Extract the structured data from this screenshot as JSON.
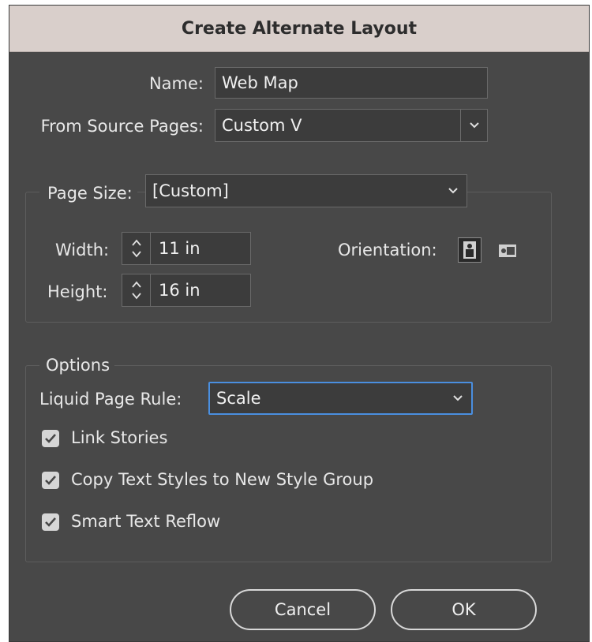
{
  "dialog": {
    "title": "Create Alternate Layout"
  },
  "name": {
    "label": "Name:",
    "value": "Web Map"
  },
  "source_pages": {
    "label": "From Source Pages:",
    "value": "Custom V"
  },
  "page_size": {
    "label": "Page Size:",
    "value": "[Custom]",
    "width_label": "Width:",
    "width_value": "11 in",
    "height_label": "Height:",
    "height_value": "16 in",
    "orientation_label": "Orientation:",
    "orientation_selected": "portrait"
  },
  "options": {
    "legend": "Options",
    "liquid_rule_label": "Liquid Page Rule:",
    "liquid_rule_value": "Scale",
    "checkboxes": [
      {
        "label": "Link Stories",
        "checked": true
      },
      {
        "label": "Copy Text Styles to New Style Group",
        "checked": true
      },
      {
        "label": "Smart Text Reflow",
        "checked": true
      }
    ]
  },
  "buttons": {
    "cancel": "Cancel",
    "ok": "OK"
  },
  "colors": {
    "dialog_bg": "#484848",
    "titlebar_bg": "#d9cfcb",
    "focus_accent": "#4a8fe0"
  }
}
